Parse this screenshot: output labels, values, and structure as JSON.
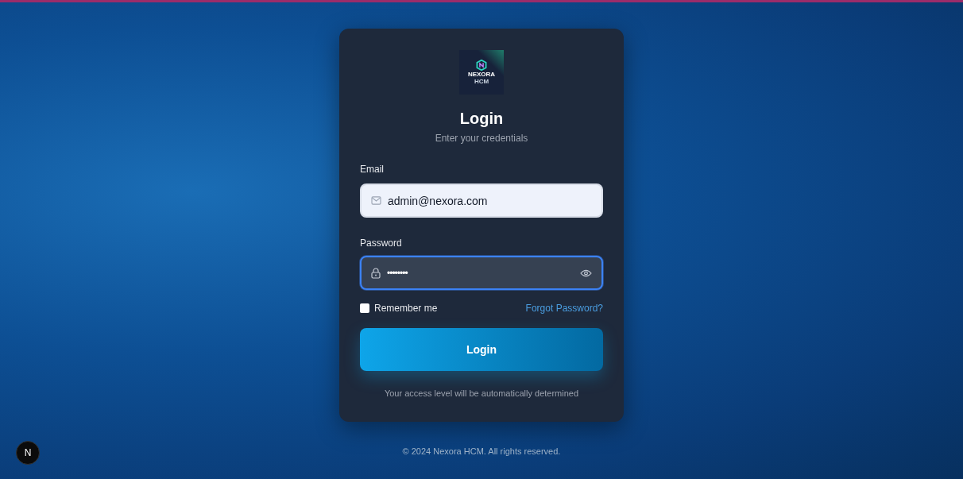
{
  "logo": {
    "name": "NEXORA",
    "subtitle": "HCM"
  },
  "title": "Login",
  "subtitle": "Enter your credentials",
  "email": {
    "label": "Email",
    "value": "admin@nexora.com",
    "focused": false
  },
  "password": {
    "label": "Password",
    "value": "••••••••",
    "focused": true
  },
  "remember": {
    "label": "Remember me",
    "checked": false
  },
  "forgot_link": "Forgot Password?",
  "login_button": "Login",
  "note": "Your access level will be automatically determined",
  "footer": "© 2024 Nexora HCM. All rights reserved.",
  "dev_badge": "N"
}
